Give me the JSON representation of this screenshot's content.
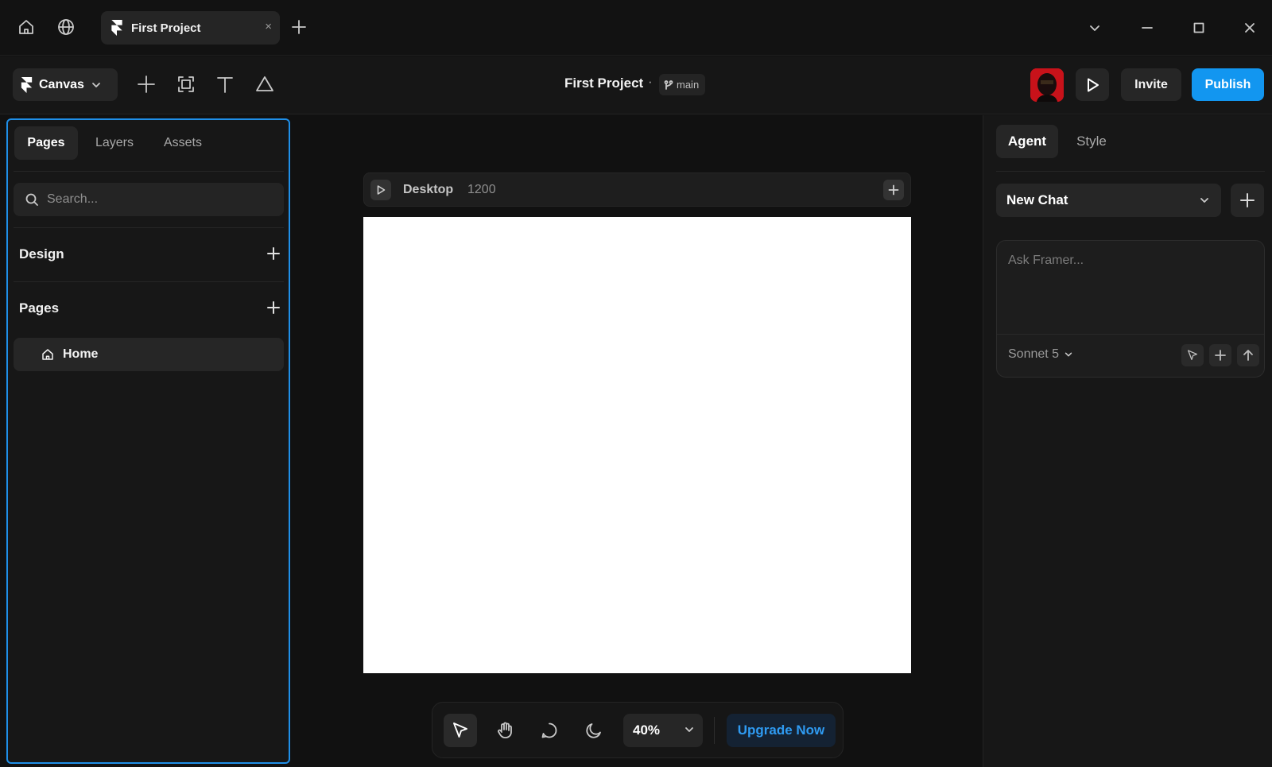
{
  "titlebar": {
    "tab_label": "First Project",
    "tab_close": "×",
    "icons": [
      "home-icon",
      "globe-icon",
      "framer-logo-icon",
      "new-tab-icon",
      "chevron-down-icon",
      "minimize-icon",
      "maximize-icon",
      "close-icon"
    ]
  },
  "toolbar": {
    "canvas_label": "Canvas",
    "project_title": "First Project",
    "separator": "·",
    "branch": "main",
    "invite_label": "Invite",
    "publish_label": "Publish"
  },
  "left_panel": {
    "tabs": [
      {
        "label": "Pages",
        "active": true
      },
      {
        "label": "Layers",
        "active": false
      },
      {
        "label": "Assets",
        "active": false
      }
    ],
    "search_placeholder": "Search...",
    "design_title": "Design",
    "pages_title": "Pages",
    "pages": [
      {
        "label": "Home",
        "icon": "home-icon"
      }
    ]
  },
  "canvas": {
    "frame_name": "Desktop",
    "frame_width": "1200"
  },
  "bottom_bar": {
    "zoom": "40%",
    "upgrade_label": "Upgrade Now"
  },
  "right_panel": {
    "tabs": [
      {
        "label": "Agent",
        "active": true
      },
      {
        "label": "Style",
        "active": false
      }
    ],
    "chat_select": "New Chat",
    "ask_placeholder": "Ask Framer...",
    "model": "Sonnet 5"
  },
  "colors": {
    "accent": "#1296f0",
    "selection_outline": "#1f8fe8",
    "upgrade_text": "#2f9bf2",
    "avatar_bg": "#d11414"
  }
}
